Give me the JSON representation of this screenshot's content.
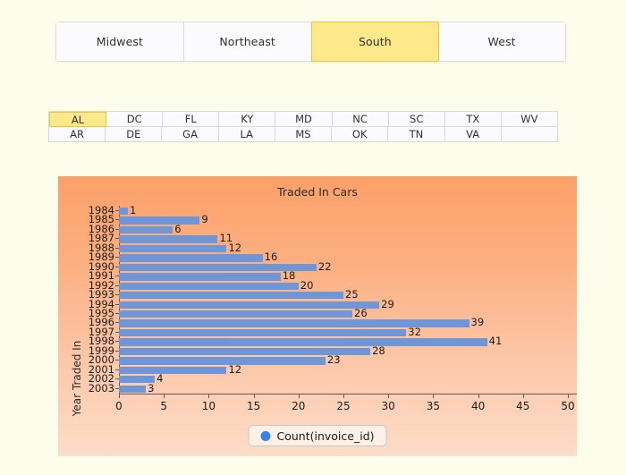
{
  "region_tabs": {
    "items": [
      {
        "label": "Midwest",
        "selected": false
      },
      {
        "label": "Northeast",
        "selected": false
      },
      {
        "label": "South",
        "selected": true
      },
      {
        "label": "West",
        "selected": false
      }
    ]
  },
  "state_grid": {
    "rows": [
      [
        {
          "label": "AL",
          "selected": true
        },
        {
          "label": "DC",
          "selected": false
        },
        {
          "label": "FL",
          "selected": false
        },
        {
          "label": "KY",
          "selected": false
        },
        {
          "label": "MD",
          "selected": false
        },
        {
          "label": "NC",
          "selected": false
        },
        {
          "label": "SC",
          "selected": false
        },
        {
          "label": "TX",
          "selected": false
        },
        {
          "label": "WV",
          "selected": false
        }
      ],
      [
        {
          "label": "AR",
          "selected": false
        },
        {
          "label": "DE",
          "selected": false
        },
        {
          "label": "GA",
          "selected": false
        },
        {
          "label": "LA",
          "selected": false
        },
        {
          "label": "MS",
          "selected": false
        },
        {
          "label": "OK",
          "selected": false
        },
        {
          "label": "TN",
          "selected": false
        },
        {
          "label": "VA",
          "selected": false
        },
        {
          "label": "",
          "selected": false
        }
      ]
    ]
  },
  "legend": {
    "label": "Count(invoice_id)",
    "color": "#3b82f0"
  },
  "colors": {
    "bar": "#6f97d8",
    "selected_highlight": "#fde98a",
    "selected_border": "#e9c73d",
    "page_background": "#fdfdeb",
    "panel_gradient_top": "#fca068",
    "panel_gradient_bottom": "#fddcc8"
  },
  "chart_data": {
    "type": "bar",
    "orientation": "horizontal",
    "title": "Traded In Cars",
    "xlabel": "",
    "ylabel": "Year Traded In",
    "xlim": [
      0,
      50
    ],
    "xticks": [
      0,
      5,
      10,
      15,
      20,
      25,
      30,
      35,
      40,
      45,
      50
    ],
    "grid": false,
    "legend_position": "bottom",
    "series": [
      {
        "name": "Count(invoice_id)",
        "values": [
          1,
          9,
          6,
          11,
          12,
          16,
          22,
          18,
          20,
          25,
          29,
          26,
          39,
          32,
          41,
          28,
          23,
          12,
          4,
          3
        ]
      }
    ],
    "categories": [
      "1984",
      "1985",
      "1986",
      "1987",
      "1988",
      "1989",
      "1990",
      "1991",
      "1992",
      "1993",
      "1994",
      "1995",
      "1996",
      "1997",
      "1998",
      "1999",
      "2000",
      "2001",
      "2002",
      "2003"
    ]
  }
}
